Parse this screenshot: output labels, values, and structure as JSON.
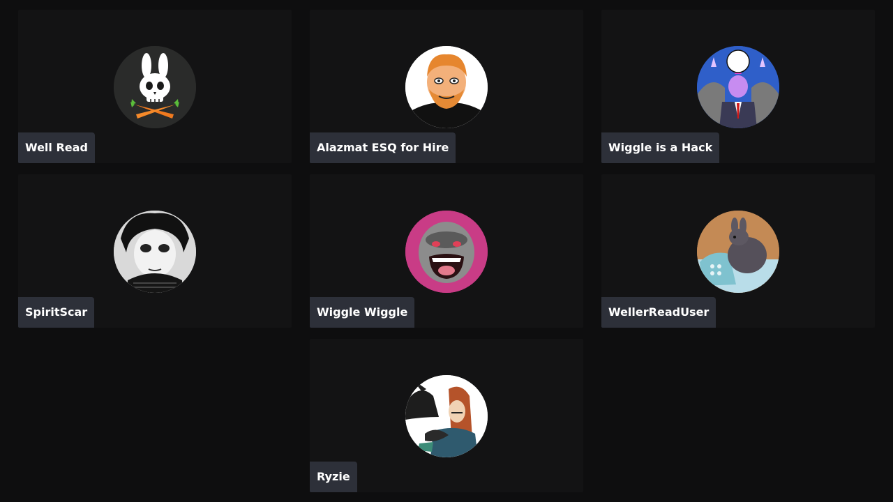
{
  "participants": [
    {
      "name": "Well Read",
      "avatar_icon": "bunny-skull-carrots-icon"
    },
    {
      "name": "Alazmat ESQ for Hire",
      "avatar_icon": "cartoon-bearded-man-icon"
    },
    {
      "name": "Wiggle is a Hack",
      "avatar_icon": "comic-muscle-man-icon"
    },
    {
      "name": "SpiritScar",
      "avatar_icon": "black-white-face-icon"
    },
    {
      "name": "Wiggle Wiggle",
      "avatar_icon": "angry-gorilla-icon"
    },
    {
      "name": "WellerReadUser",
      "avatar_icon": "rabbit-telephone-icon"
    },
    {
      "name": "Ryzie",
      "avatar_icon": "woman-with-crow-icon"
    }
  ],
  "colors": {
    "background": "#0e0e0f",
    "tile": "#131314",
    "nameplate": "#2d3039",
    "text": "#ffffff"
  }
}
